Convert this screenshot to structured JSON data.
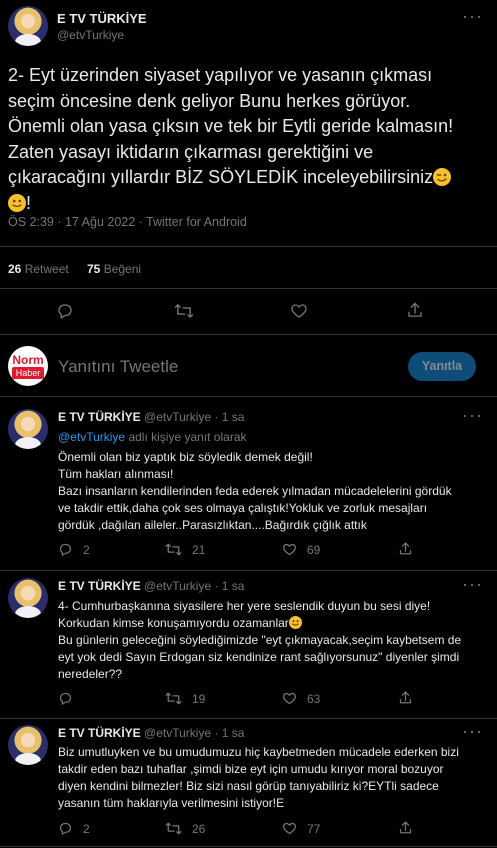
{
  "tweet": {
    "display_name": "E TV TÜRKİYE",
    "handle": "@etvTurkiye",
    "lines": [
      "2- Eyt üzerinden siyaset yapılıyor ve yasanın çıkması",
      "seçim öncesine denk geliyor Bunu herkes görüyor.",
      "Önemli olan yasa çıksın ve tek bir Eytli geride kalmasın!",
      "Zaten yasayı iktidarın çıkarması gerektiğini ve",
      "çıkaracağını yıllardır BİZ SÖYLEDİK inceleyebilirsiniz"
    ],
    "last_line_end": "!",
    "emojis": [
      "wink-face",
      "slightly-smiling-face"
    ],
    "meta": "ÖS 2:39 · 17 Ağu 2022 · Twitter for Android",
    "retweet_count": "26",
    "retweet_label": "Retweet",
    "like_count": "75",
    "like_label": "Beğeni"
  },
  "reply_box": {
    "logo_top": "Norm",
    "logo_bottom": "Haber",
    "placeholder": "Yanıtını Tweetle",
    "button": "Yanıtla"
  },
  "replies": [
    {
      "name": "E TV TÜRKİYE",
      "handle": "@etvTurkiye",
      "time": "· 1 sa",
      "replying_mention": "@etvTurkiye",
      "replying_suffix": "adlı kişiye yanıt olarak",
      "lines": [
        "Önemli olan biz yaptık biz söyledik demek değil!",
        "Tüm hakları alınması!",
        "Bazı insanların kendilerinden feda ederek yılmadan mücadelelerini gördük",
        "ve takdir ettik,daha çok ses olmaya çalıştık!Yokluk ve zorluk mesajları",
        "gördük ,dağılan aileler..Parasızlıktan....Bağırdık çığlık attık"
      ],
      "replies": "2",
      "retweets": "21",
      "likes": "69"
    },
    {
      "name": "E TV TÜRKİYE",
      "handle": "@etvTurkiye",
      "time": "· 1 sa",
      "lines": [
        "4- Cumhurbaşkanına siyasilere her yere seslendik duyun bu sesi diye!",
        "Korkudan kimse konuşamıyordu ozamanlar",
        "Bu günlerin geleceğini söylediğimizde \"eyt çıkmayacak,seçim kaybetsem de",
        "eyt yok dedi Sayın Erdogan siz kendinize rant sağlıyorsunuz\" diyenler şimdi",
        "neredeler??"
      ],
      "replies": "",
      "retweets": "19",
      "likes": "63"
    },
    {
      "name": "E TV TÜRKİYE",
      "handle": "@etvTurkiye",
      "time": "· 1 sa",
      "lines": [
        "Biz umutluyken ve bu umudumuzu hiç kaybetmeden mücadele ederken bizi",
        "takdir eden bazı tuhaflar ,şimdi bize eyt için umudu kırıyor moral bozuyor",
        "diyen kendini bilmezler! Biz sizi nasıl görüp tanıyabiliriz ki?EYTli sadece",
        "yasanın tüm haklarıyla verilmesini istiyor!E"
      ],
      "replies": "2",
      "retweets": "26",
      "likes": "77"
    }
  ],
  "colors": {
    "background": "#000000",
    "accent": "#1d9bf0",
    "muted": "#71767b",
    "divider": "#2f3336"
  }
}
